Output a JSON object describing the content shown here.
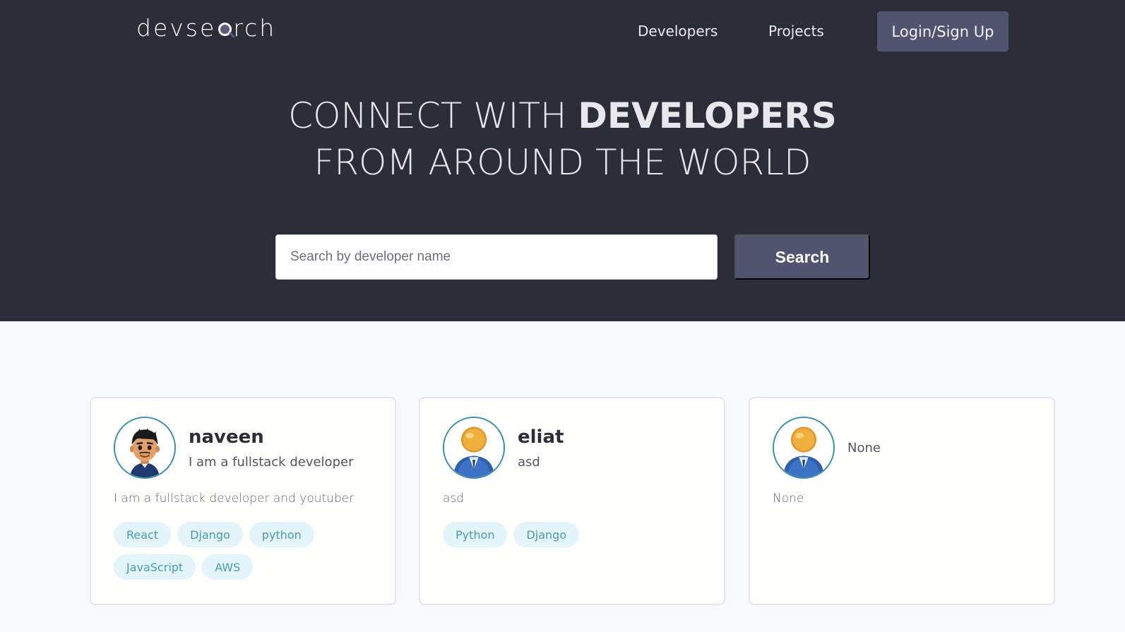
{
  "header": {
    "logo_prefix": "devse",
    "logo_suffix": "rch",
    "nav": {
      "developers": "Developers",
      "projects": "Projects"
    },
    "login_label": "Login/Sign Up"
  },
  "hero": {
    "line1_light": "CONNECT WITH ",
    "line1_bold": "DEVELOPERS",
    "line2": "FROM AROUND THE WORLD"
  },
  "search": {
    "placeholder": "Search by developer name",
    "button_label": "Search"
  },
  "developers": [
    {
      "name": "naveen",
      "title": "I am a fullstack developer",
      "bio": "I am a fullstack developer and youtuber",
      "tags": [
        "React",
        "Django",
        "python",
        "JavaScript",
        "AWS"
      ],
      "avatar": "cartoon-man-avatar"
    },
    {
      "name": "eliat",
      "title": "asd",
      "bio": "asd",
      "tags": [
        "Python",
        "Django"
      ],
      "avatar": "default-user-avatar"
    },
    {
      "name": "",
      "title": "None",
      "bio": "None",
      "tags": [],
      "avatar": "default-user-avatar"
    }
  ],
  "colors": {
    "header_bg": "#2d2d39",
    "accent_btn": "#51546e",
    "tag_bg": "#e3f5fb",
    "tag_text": "#4a9ab3",
    "avatar_ring": "#3a8fa8"
  }
}
